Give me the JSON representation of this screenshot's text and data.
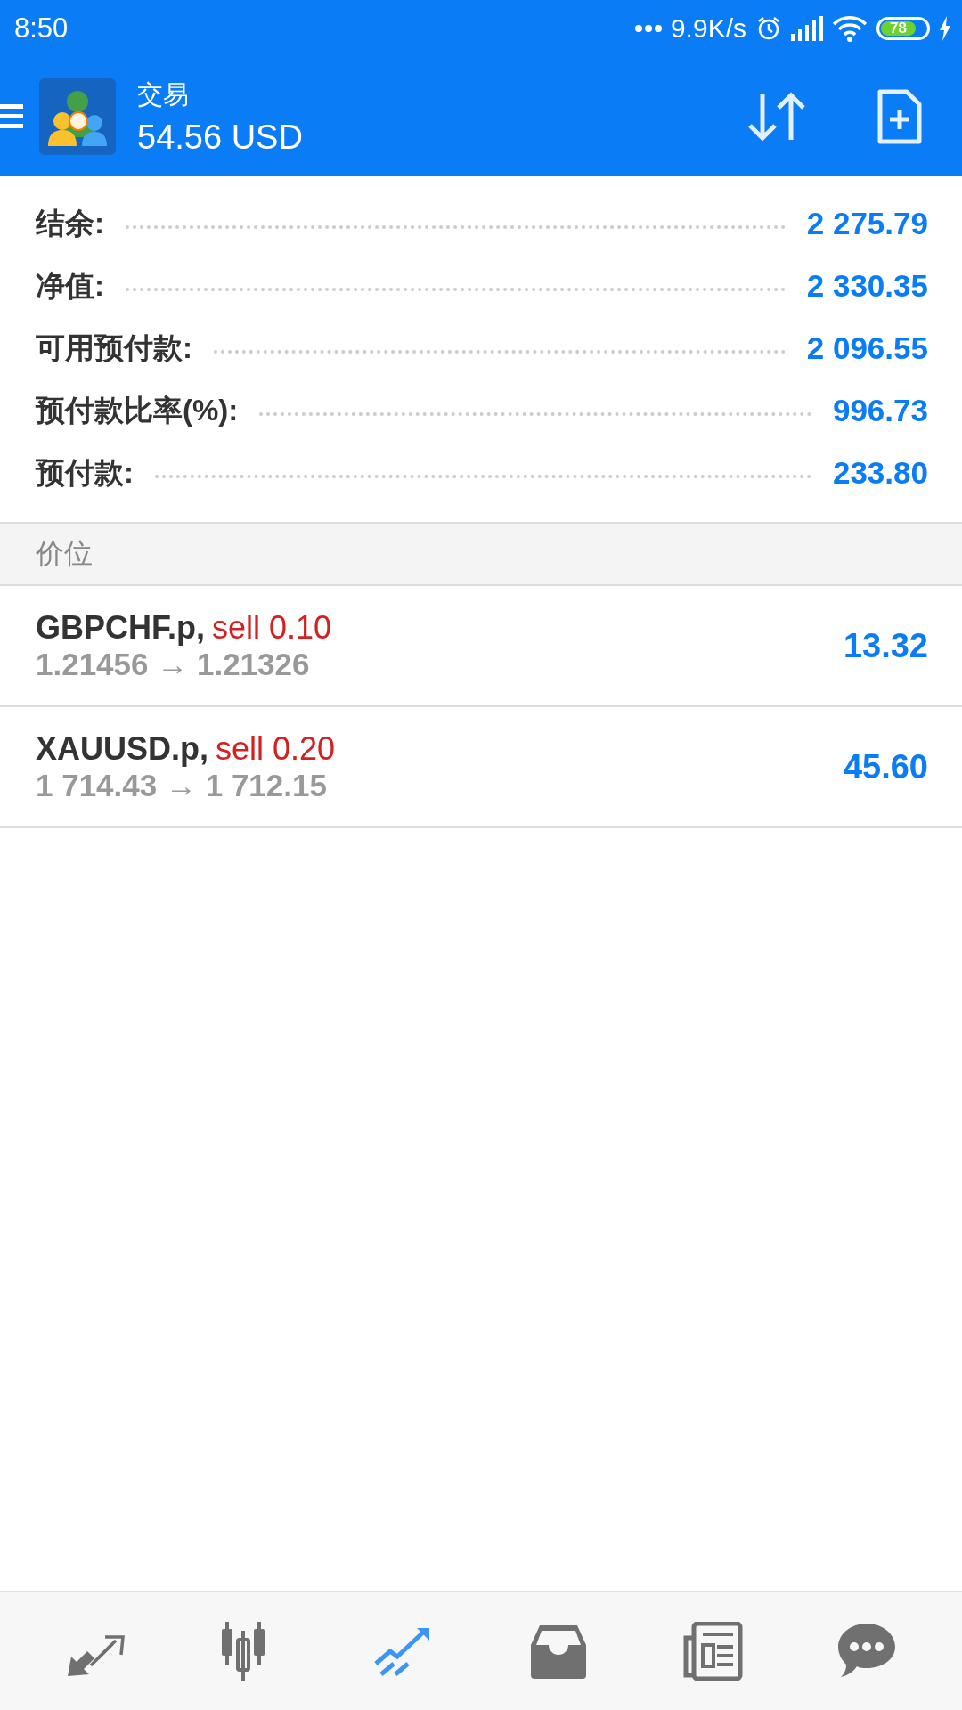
{
  "status_bar": {
    "time": "8:50",
    "network_speed": "9.9K/s",
    "battery": "78"
  },
  "header": {
    "title": "交易",
    "subtitle": "54.56 USD"
  },
  "summary": [
    {
      "label": "结余:",
      "value": "2 275.79"
    },
    {
      "label": "净值:",
      "value": "2 330.35"
    },
    {
      "label": "可用预付款:",
      "value": "2 096.55"
    },
    {
      "label": "预付款比率(%):",
      "value": "996.73"
    },
    {
      "label": "预付款:",
      "value": "233.80"
    }
  ],
  "section": {
    "title": "价位"
  },
  "positions": [
    {
      "symbol": "GBPCHF.p,",
      "order": "sell 0.10",
      "prices": "1.21456 → 1.21326",
      "profit": "13.32"
    },
    {
      "symbol": "XAUUSD.p,",
      "order": "sell 0.20",
      "prices": "1 714.43 → 1 712.15",
      "profit": "45.60"
    }
  ],
  "bottom_nav": [
    {
      "kind": "quotes",
      "selected": false
    },
    {
      "kind": "chart",
      "selected": false
    },
    {
      "kind": "trade",
      "selected": true
    },
    {
      "kind": "history",
      "selected": false
    },
    {
      "kind": "news",
      "selected": false
    },
    {
      "kind": "chat",
      "selected": false
    }
  ]
}
